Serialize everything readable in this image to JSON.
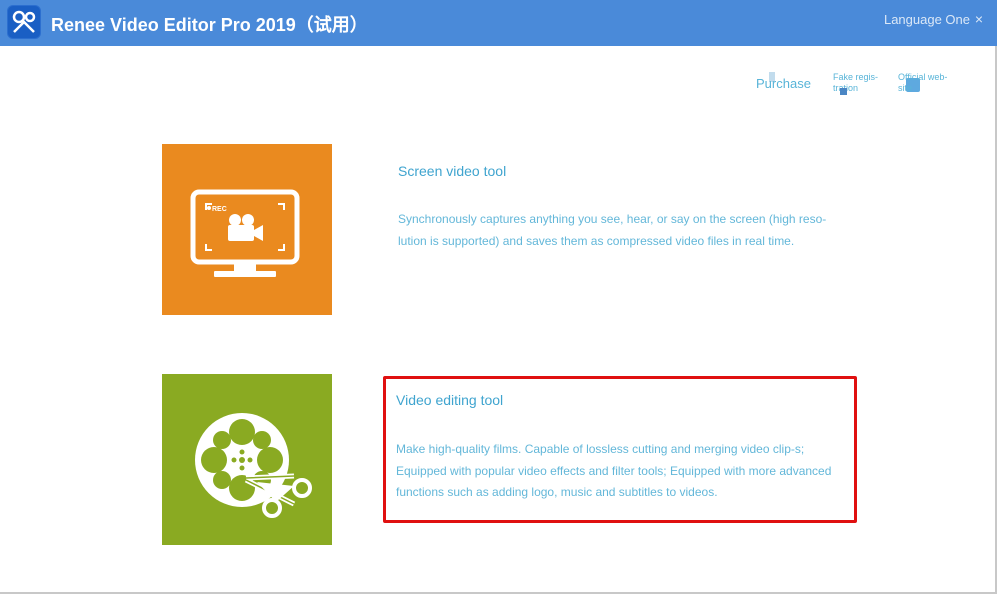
{
  "window": {
    "title": "Renee Video Editor Pro 2019（试用）",
    "language": "Language One",
    "close_glyph": "×",
    "logo_icon": "renee-logo-icon"
  },
  "toplinks": {
    "purchase": "Purchase",
    "fake_registration": "Fake regis-tration",
    "official_website": "Official web-site"
  },
  "tools": [
    {
      "title": "Screen video tool",
      "description": "Synchronously captures anything you see, hear, or say on the screen (high reso-lution is supported) and saves them as compressed video files in real time.",
      "icon": "screen-record-icon",
      "rec_label": "REC",
      "tile_color": "#ea8a1f"
    },
    {
      "title": "Video editing tool",
      "description": "Make high-quality films. Capable of lossless cutting and merging video clip-s; Equipped with popular video effects and filter tools; Equipped with more advanced functions such as adding logo, music and subtitles to videos.",
      "icon": "film-reel-scissors-icon",
      "tile_color": "#8aaa22"
    }
  ],
  "colors": {
    "titlebar": "#4a8ad9",
    "link": "#58b4d8",
    "highlight_border": "#e01010"
  }
}
